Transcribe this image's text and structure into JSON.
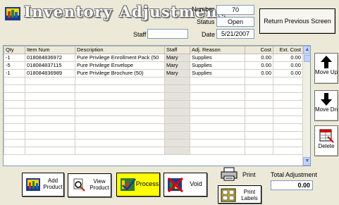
{
  "header": {
    "title": "Inventory Adjustment",
    "number_label": "Number",
    "number_value": "70",
    "status_label": "Status",
    "status_value": "Open",
    "staff_label": "Staff",
    "staff_value": "",
    "date_label": "Date",
    "date_value": "5/21/2007",
    "return_button": "Return Previous Screen"
  },
  "grid": {
    "columns": [
      "Qty",
      "Item Num",
      "Description",
      "Staff",
      "Adj. Reason",
      "Cost",
      "Ext. Cost"
    ],
    "rows": [
      {
        "qty": "-1",
        "item": "018084836972",
        "desc": "Pure Privilege Enrollment Pack (50",
        "staff": "Mary",
        "reason": "Supplies",
        "cost": "0.00",
        "ext": "0.00"
      },
      {
        "qty": "-5",
        "item": "018084837115",
        "desc": "Pure Privilege Envelope",
        "staff": "Mary",
        "reason": "Supplies",
        "cost": "0.00",
        "ext": "0.00"
      },
      {
        "qty": "-1",
        "item": "018084836989",
        "desc": "Pure Privilege Brochure (50)",
        "staff": "Mary",
        "reason": "Supplies",
        "cost": "0.00",
        "ext": "0.00"
      }
    ]
  },
  "side": {
    "move_up": "Move Up",
    "move_dn": "Move Dn",
    "delete": "Delete"
  },
  "bottom": {
    "add_product_1": "Add",
    "add_product_2": "Product",
    "view_product_1": "View",
    "view_product_2": "Product",
    "process": "Process",
    "void": "Void",
    "print": "Print",
    "print_labels_1": "Print",
    "print_labels_2": "Labels",
    "total_label": "Total Adjustment",
    "total_value": "0.00"
  },
  "colors": {
    "window_bg": "#ece9d8",
    "process_bg": "#ffff00",
    "field_border": "#7f9db9"
  },
  "icons": [
    "inventory-icon",
    "arrow-up-icon",
    "arrow-down-icon",
    "delete-icon",
    "add-product-icon",
    "view-product-icon",
    "process-icon",
    "void-icon",
    "printer-icon",
    "labels-icon"
  ]
}
